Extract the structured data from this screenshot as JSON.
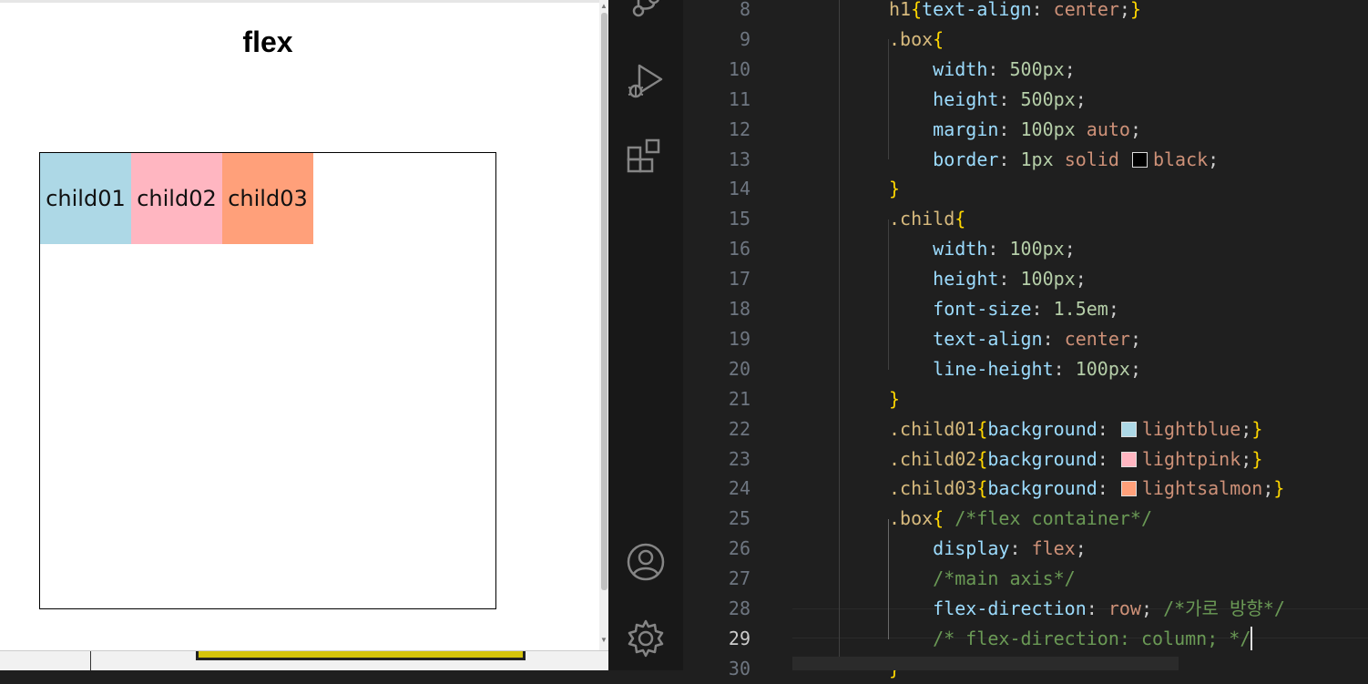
{
  "browser": {
    "title": "flex",
    "children": [
      {
        "label": "child01",
        "color": "#add8e6"
      },
      {
        "label": "child02",
        "color": "#ffb6c1"
      },
      {
        "label": "child03",
        "color": "#ffa07a"
      }
    ]
  },
  "editor": {
    "lines": [
      {
        "n": "8",
        "html": "<span class='sel'>h1</span><span class='brace'>{</span><span class='prop'>text-align</span>: <span class='kw'>center</span>;<span class='brace'>}</span>"
      },
      {
        "n": "9",
        "html": "<span class='sel'>.box</span><span class='brace'>{</span>"
      },
      {
        "n": "10",
        "html": "    <span class='prop'>width</span>: <span class='num'>500px</span>;"
      },
      {
        "n": "11",
        "html": "    <span class='prop'>height</span>: <span class='num'>500px</span>;"
      },
      {
        "n": "12",
        "html": "    <span class='prop'>margin</span>: <span class='num'>100px</span> <span class='kw'>auto</span>;"
      },
      {
        "n": "13",
        "html": "    <span class='prop'>border</span>: <span class='num'>1px</span> <span class='kw'>solid</span> <span class='swatch' data-name='color-swatch-black' style='background:#000'></span><span class='kw'>black</span>;"
      },
      {
        "n": "14",
        "html": "<span class='brace'>}</span>"
      },
      {
        "n": "15",
        "html": "<span class='sel'>.child</span><span class='brace'>{</span>"
      },
      {
        "n": "16",
        "html": "    <span class='prop'>width</span>: <span class='num'>100px</span>;"
      },
      {
        "n": "17",
        "html": "    <span class='prop'>height</span>: <span class='num'>100px</span>;"
      },
      {
        "n": "18",
        "html": "    <span class='prop'>font-size</span>: <span class='num'>1.5em</span>;"
      },
      {
        "n": "19",
        "html": "    <span class='prop'>text-align</span>: <span class='kw'>center</span>;"
      },
      {
        "n": "20",
        "html": "    <span class='prop'>line-height</span>: <span class='num'>100px</span>;"
      },
      {
        "n": "21",
        "html": "<span class='brace'>}</span>"
      },
      {
        "n": "22",
        "html": "<span class='sel'>.child01</span><span class='brace'>{</span><span class='prop'>background</span>: <span class='swatch' data-name='color-swatch-lightblue' style='background:#add8e6'></span><span class='kw'>lightblue</span>;<span class='brace'>}</span>"
      },
      {
        "n": "23",
        "html": "<span class='sel'>.child02</span><span class='brace'>{</span><span class='prop'>background</span>: <span class='swatch' data-name='color-swatch-lightpink' style='background:#ffb6c1'></span><span class='kw'>lightpink</span>;<span class='brace'>}</span>"
      },
      {
        "n": "24",
        "html": "<span class='sel'>.child03</span><span class='brace'>{</span><span class='prop'>background</span>: <span class='swatch' data-name='color-swatch-lightsalmon' style='background:#ffa07a'></span><span class='kw'>lightsalmon</span>;<span class='brace'>}</span>"
      },
      {
        "n": "25",
        "html": "<span class='sel'>.box</span><span class='brace'>{</span> <span class='cmt'>/*flex container*/</span>"
      },
      {
        "n": "26",
        "html": "    <span class='prop'>display</span>: <span class='kw'>flex</span>;"
      },
      {
        "n": "27",
        "html": "    <span class='cmt'>/*main axis*/</span>"
      },
      {
        "n": "28",
        "html": "    <span class='prop'>flex-direction</span>: <span class='kw'>row</span>; <span class='cmt'>/*가로 방향*/</span>"
      },
      {
        "n": "29",
        "html": "    <span class='cmt'>/* flex-direction: column; */</span><span class='cursor' data-name='text-cursor'></span>"
      },
      {
        "n": "30",
        "html": "<span class='brace'>}</span>"
      }
    ],
    "active_line": "29"
  }
}
